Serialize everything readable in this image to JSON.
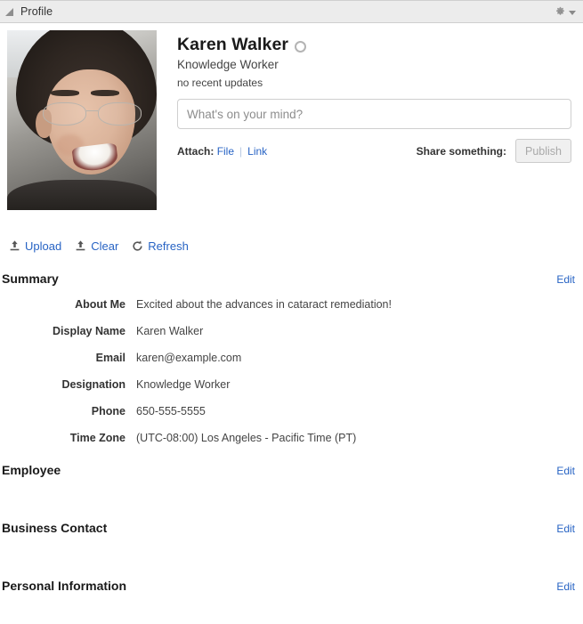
{
  "header": {
    "title": "Profile",
    "collapse_icon": "triangle-collapse-icon",
    "gear_icon": "gear-icon",
    "caret_icon": "chevron-down-icon"
  },
  "profile": {
    "avatar_alt": "Karen Walker profile photo",
    "name": "Karen Walker",
    "presence_icon": "presence-status-icon",
    "title": "Knowledge Worker",
    "updates": "no recent updates"
  },
  "share": {
    "placeholder": "What's on your mind?",
    "value": "",
    "attach_label": "Attach:",
    "attach_file": "File",
    "attach_separator": "|",
    "attach_link": "Link",
    "share_label": "Share something:",
    "publish_label": "Publish"
  },
  "actions": [
    {
      "label": "Upload",
      "icon": "upload-icon"
    },
    {
      "label": "Clear",
      "icon": "upload-icon"
    },
    {
      "label": "Refresh",
      "icon": "refresh-icon"
    }
  ],
  "sections": [
    {
      "title": "Summary",
      "edit_label": "Edit"
    },
    {
      "title": "Employee",
      "edit_label": "Edit"
    },
    {
      "title": "Business Contact",
      "edit_label": "Edit"
    },
    {
      "title": "Personal Information",
      "edit_label": "Edit"
    }
  ],
  "summary_details": [
    {
      "label": "About Me",
      "value": "Excited about the advances in cataract remediation!"
    },
    {
      "label": "Display Name",
      "value": "Karen Walker"
    },
    {
      "label": "Email",
      "value": "karen@example.com"
    },
    {
      "label": "Designation",
      "value": "Knowledge Worker"
    },
    {
      "label": "Phone",
      "value": "650-555-5555"
    },
    {
      "label": "Time Zone",
      "value": "(UTC-08:00) Los Angeles - Pacific Time (PT)"
    }
  ],
  "colors": {
    "link": "#2763c4",
    "header_bg": "#ececec",
    "text": "#333333"
  }
}
